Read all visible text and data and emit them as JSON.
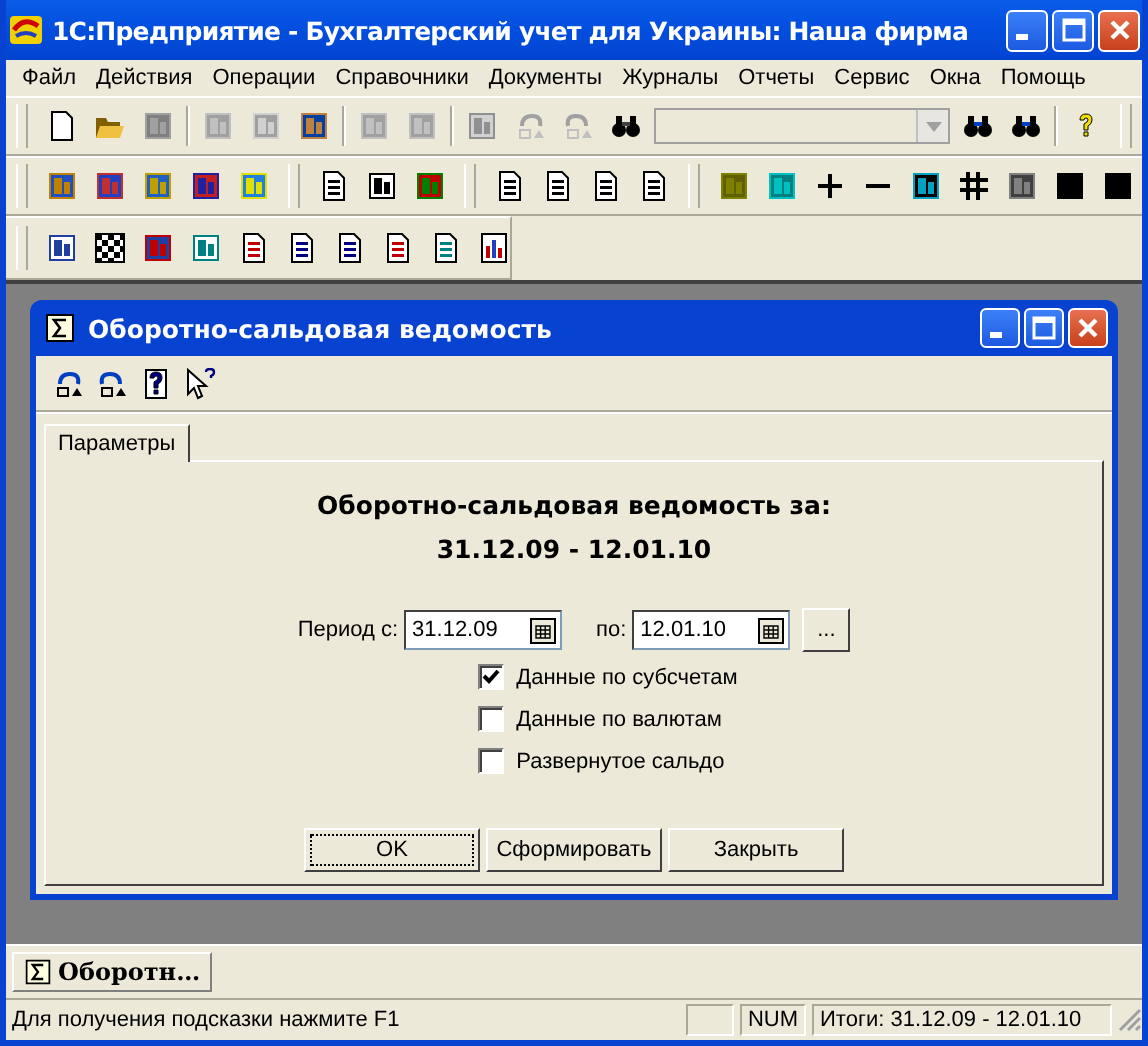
{
  "window": {
    "title": "1С:Предприятие  - Бухгалтерский учет для Украины: Наша фирма"
  },
  "menu": [
    {
      "label": "Файл"
    },
    {
      "label": "Действия"
    },
    {
      "label": "Операции"
    },
    {
      "label": "Справочники"
    },
    {
      "label": "Документы"
    },
    {
      "label": "Журналы"
    },
    {
      "label": "Отчеты"
    },
    {
      "label": "Сервис"
    },
    {
      "label": "Окна"
    },
    {
      "label": "Помощь"
    }
  ],
  "child_window": {
    "title": "Оборотно-сальдовая ведомость",
    "tabs": [
      {
        "label": "Параметры",
        "selected": true
      }
    ],
    "heading": "Оборотно-сальдовая ведомость за:",
    "period_text": "31.12.09 - 12.01.10",
    "period": {
      "from_label": "Период с:",
      "from": "31.12.09",
      "to_label": "по:",
      "to": "12.01.10",
      "more_button": "..."
    },
    "options": [
      {
        "label": "Данные по субсчетам",
        "checked": true
      },
      {
        "label": "Данные по валютам",
        "checked": false
      },
      {
        "label": "Развернутое сальдо",
        "checked": false
      }
    ],
    "buttons": [
      {
        "label": "OK",
        "default": true
      },
      {
        "label": "Сформировать",
        "default": false
      },
      {
        "label": "Закрыть",
        "default": false
      }
    ]
  },
  "taskbar": [
    {
      "label": "Оборотн…"
    }
  ],
  "status_bar": {
    "hint": "Для получения подсказки нажмите F1",
    "indicator": "NUM",
    "totals": "Итоги: 31.12.09 - 12.01.10"
  }
}
